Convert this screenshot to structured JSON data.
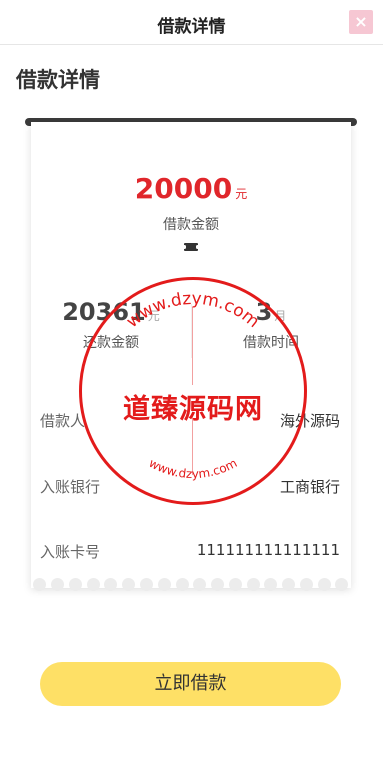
{
  "header": {
    "title": "借款详情"
  },
  "page": {
    "heading": "借款详情"
  },
  "loan": {
    "amount": "20000",
    "amount_unit": "元",
    "amount_label": "借款金额"
  },
  "stats": {
    "repay_amount": "20361",
    "repay_unit": "元",
    "repay_label": "还款金额",
    "term": "3",
    "term_unit": "月",
    "term_label": "借款时间"
  },
  "details": [
    {
      "key": "借款人",
      "value": "海外源码"
    },
    {
      "key": "入账银行",
      "value": "工商银行"
    },
    {
      "key": "入账卡号",
      "value": "111111111111111"
    }
  ],
  "stamp": {
    "center": "道臻源码网",
    "ring_top": "www.dzym.com",
    "ring_bottom": "www.dzym.com",
    "color": "#e31b1b"
  },
  "cta": {
    "label": "立即借款"
  }
}
